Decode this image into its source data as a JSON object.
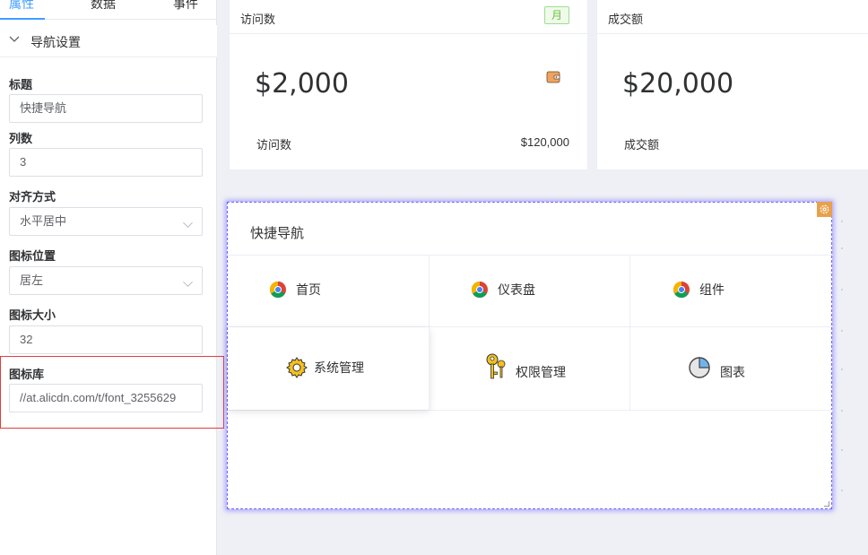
{
  "tabs": [
    "属性",
    "数据",
    "事件"
  ],
  "section": {
    "title": "导航设置"
  },
  "form": {
    "title_label": "标题",
    "title_value": "快捷导航",
    "columns_label": "列数",
    "columns_value": "3",
    "align_label": "对齐方式",
    "align_value": "水平居中",
    "icon_pos_label": "图标位置",
    "icon_pos_value": "居左",
    "icon_size_label": "图标大小",
    "icon_size_value": "32",
    "icon_lib_label": "图标库",
    "icon_lib_value": "//at.alicdn.com/t/font_3255629"
  },
  "cards": [
    {
      "title": "访问数",
      "badge": "月",
      "value": "$2,000",
      "sub_label": "访问数",
      "sub_value": "$120,000",
      "icon": "wallet-icon"
    },
    {
      "title": "成交额",
      "value": "$20,000",
      "sub_label": "成交额"
    }
  ],
  "nav": {
    "title": "快捷导航",
    "items": [
      {
        "label": "首页",
        "icon": "chrome-icon"
      },
      {
        "label": "仪表盘",
        "icon": "chrome-icon"
      },
      {
        "label": "组件",
        "icon": "chrome-icon"
      },
      {
        "label": "系统管理",
        "icon": "gear-icon"
      },
      {
        "label": "权限管理",
        "icon": "key-icon"
      },
      {
        "label": "图表",
        "icon": "pie-chart-icon"
      }
    ]
  },
  "colors": {
    "accent": "#409eff",
    "selection_border": "#6b67ff",
    "highlight_box": "#e43c3c",
    "badge_green": "#67c23a"
  }
}
